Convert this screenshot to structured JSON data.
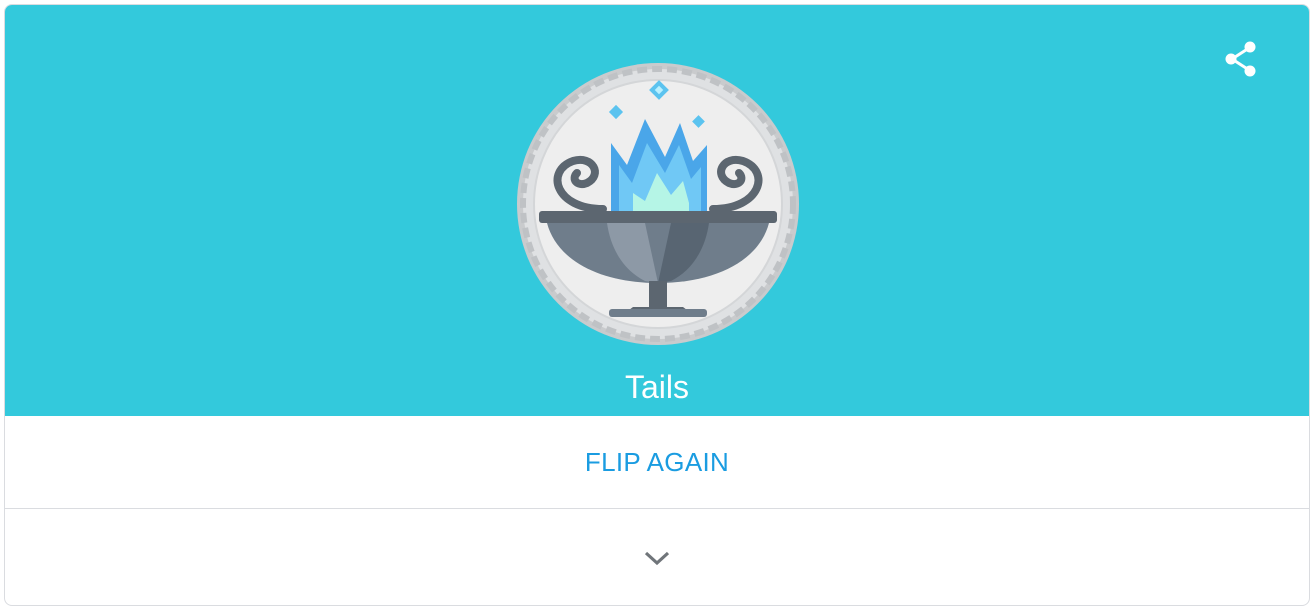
{
  "coin_flip": {
    "result": "Tails",
    "flip_again_label": "FLIP AGAIN",
    "coin_face": "tails-brazier-flame",
    "icons": {
      "share": "share-icon",
      "expand": "chevron-down-icon"
    },
    "colors": {
      "banner": "#33c9dc",
      "button_text": "#1a9ce1",
      "result_text": "#ffffff"
    }
  }
}
